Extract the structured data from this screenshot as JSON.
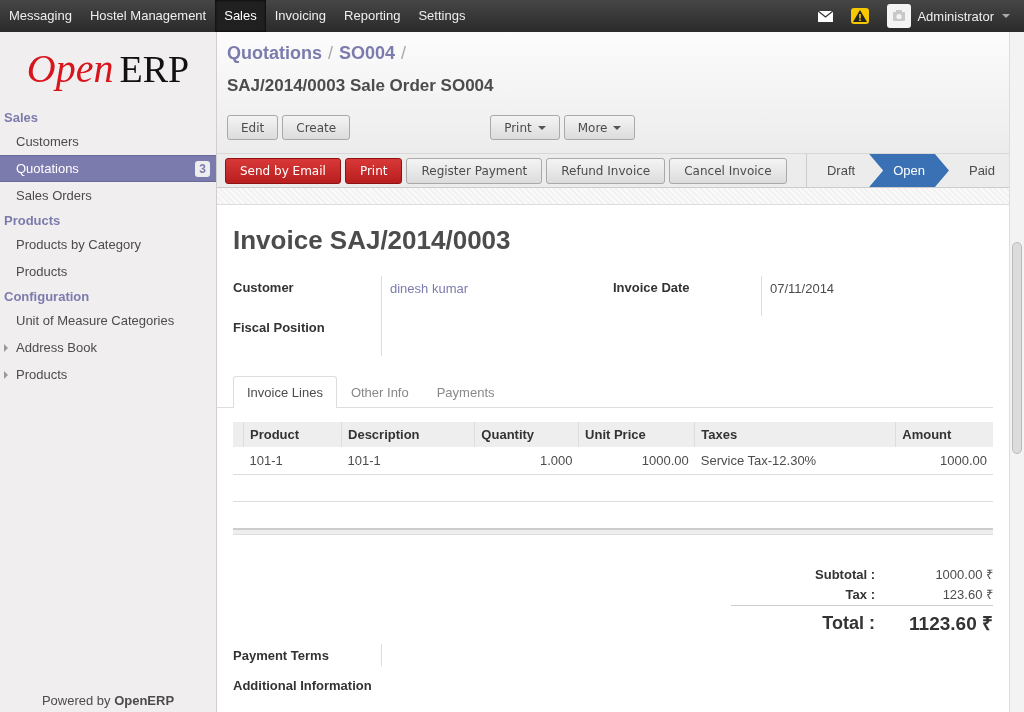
{
  "top_menu": [
    {
      "label": "Messaging",
      "selected": false
    },
    {
      "label": "Hostel Management",
      "selected": false
    },
    {
      "label": "Sales",
      "selected": true
    },
    {
      "label": "Invoicing",
      "selected": false
    },
    {
      "label": "Reporting",
      "selected": false
    },
    {
      "label": "Settings",
      "selected": false
    }
  ],
  "user": {
    "name": "Administrator"
  },
  "sidebar": {
    "logo": {
      "part_1": "Open",
      "part_2": "ERP"
    },
    "sections": [
      {
        "title": "Sales",
        "items": [
          {
            "label": "Customers",
            "selected": false,
            "kind": "link"
          },
          {
            "label": "Quotations",
            "selected": true,
            "kind": "link",
            "badge": "3"
          },
          {
            "label": "Sales Orders",
            "selected": false,
            "kind": "link"
          }
        ]
      },
      {
        "title": "Products",
        "items": [
          {
            "label": "Products by Category",
            "selected": false,
            "kind": "link"
          },
          {
            "label": "Products",
            "selected": false,
            "kind": "link"
          }
        ]
      },
      {
        "title": "Configuration",
        "items": [
          {
            "label": "Unit of Measure Categories",
            "selected": false,
            "kind": "link"
          },
          {
            "label": "Address Book",
            "selected": false,
            "kind": "folder"
          },
          {
            "label": "Products",
            "selected": false,
            "kind": "folder"
          }
        ]
      }
    ],
    "footer": "Powered by **OpenERP**"
  },
  "breadcrumb": [
    {
      "label": "Quotations",
      "separator": "/"
    },
    {
      "label": "SO004",
      "separator": "/"
    }
  ],
  "page_title": "SAJ/2014/0003 Sale Order SO004",
  "toolbar": {
    "left": [
      {
        "label": "Edit",
        "dropdown": false
      },
      {
        "label": "Create",
        "dropdown": false
      }
    ],
    "right": [
      {
        "label": "Print",
        "dropdown": true
      },
      {
        "label": "More",
        "dropdown": true
      }
    ]
  },
  "actions": [
    {
      "label": "Send by Email",
      "kind": "primary"
    },
    {
      "label": "Print",
      "kind": "primary"
    },
    {
      "label": "Register Payment",
      "kind": "default"
    },
    {
      "label": "Refund Invoice",
      "kind": "default"
    },
    {
      "label": "Cancel Invoice",
      "kind": "default"
    }
  ],
  "statusbar": [
    {
      "label": "Draft",
      "selected": false
    },
    {
      "label": "Open",
      "selected": true
    },
    {
      "label": "Paid",
      "selected": false
    }
  ],
  "sheet": {
    "title": "Invoice SAJ/2014/0003",
    "fields_left": [
      {
        "label": "Customer",
        "value": "dinesh kumar",
        "kind": "link"
      },
      {
        "label": "Fiscal Position",
        "kind": "empty"
      }
    ],
    "fields_right": [
      {
        "label": "Invoice Date",
        "value": "07/11/2014",
        "kind": "text"
      }
    ],
    "tabs": [
      {
        "label": "Invoice Lines",
        "selected": true
      },
      {
        "label": "Other Info",
        "selected": false
      },
      {
        "label": "Payments",
        "selected": false
      }
    ],
    "table": {
      "columns": [
        {
          "label": "Product",
          "numeric": false
        },
        {
          "label": "Description",
          "numeric": false
        },
        {
          "label": "Quantity",
          "numeric": true
        },
        {
          "label": "Unit Price",
          "numeric": true
        },
        {
          "label": "Taxes",
          "numeric": false
        },
        {
          "label": "Amount",
          "numeric": true
        }
      ],
      "rows": [
        [
          "101-1",
          "101-1",
          "1.000",
          "1000.00",
          "Service Tax-12.30%",
          "1000.00"
        ]
      ]
    },
    "totals": [
      {
        "label": "Subtotal :",
        "value": "1000.00 ₹",
        "kind": "line"
      },
      {
        "label": "Tax :",
        "value": "123.60 ₹",
        "kind": "line"
      },
      {
        "label": "Total :",
        "value": "1123.60 ₹",
        "kind": "grand"
      }
    ],
    "bottom_fields": [
      {
        "label": "Payment Terms",
        "kind": "field"
      },
      {
        "label": "Additional Information",
        "kind": "plain"
      }
    ]
  }
}
